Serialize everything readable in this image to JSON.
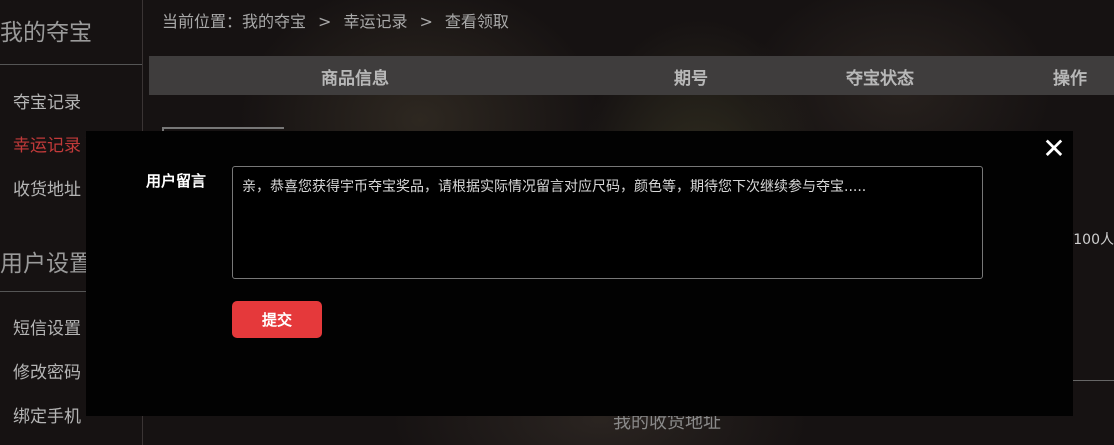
{
  "sidebar": {
    "section1_title": "我的夺宝",
    "section1_items": [
      "夺宝记录",
      "幸运记录",
      "收货地址"
    ],
    "active_mark": "✦",
    "section2_title": "用户设置",
    "section2_items": [
      "短信设置",
      "修改密码",
      "绑定手机"
    ]
  },
  "breadcrumb": {
    "prefix": "当前位置：",
    "items": [
      "我的夺宝",
      "幸运记录",
      "查看领取"
    ],
    "separator": ">"
  },
  "table": {
    "headers": [
      "商品信息",
      "期号",
      "夺宝状态",
      "操作"
    ]
  },
  "background_text": {
    "right_partial": "/100人",
    "bottom_title": "我的收货地址"
  },
  "modal": {
    "close_icon": "close-icon",
    "close_glyph": "✕",
    "label": "用户留言",
    "message_value": "亲，恭喜您获得宇币夺宝奖品，请根据实际情况留言对应尺码，颜色等，期待您下次继续参与夺宝.....",
    "submit_label": "提交"
  },
  "colors": {
    "accent": "#e5393b",
    "active_link": "#c23a3a",
    "header_bg": "#3f3d3d",
    "modal_bg": "#020202"
  }
}
